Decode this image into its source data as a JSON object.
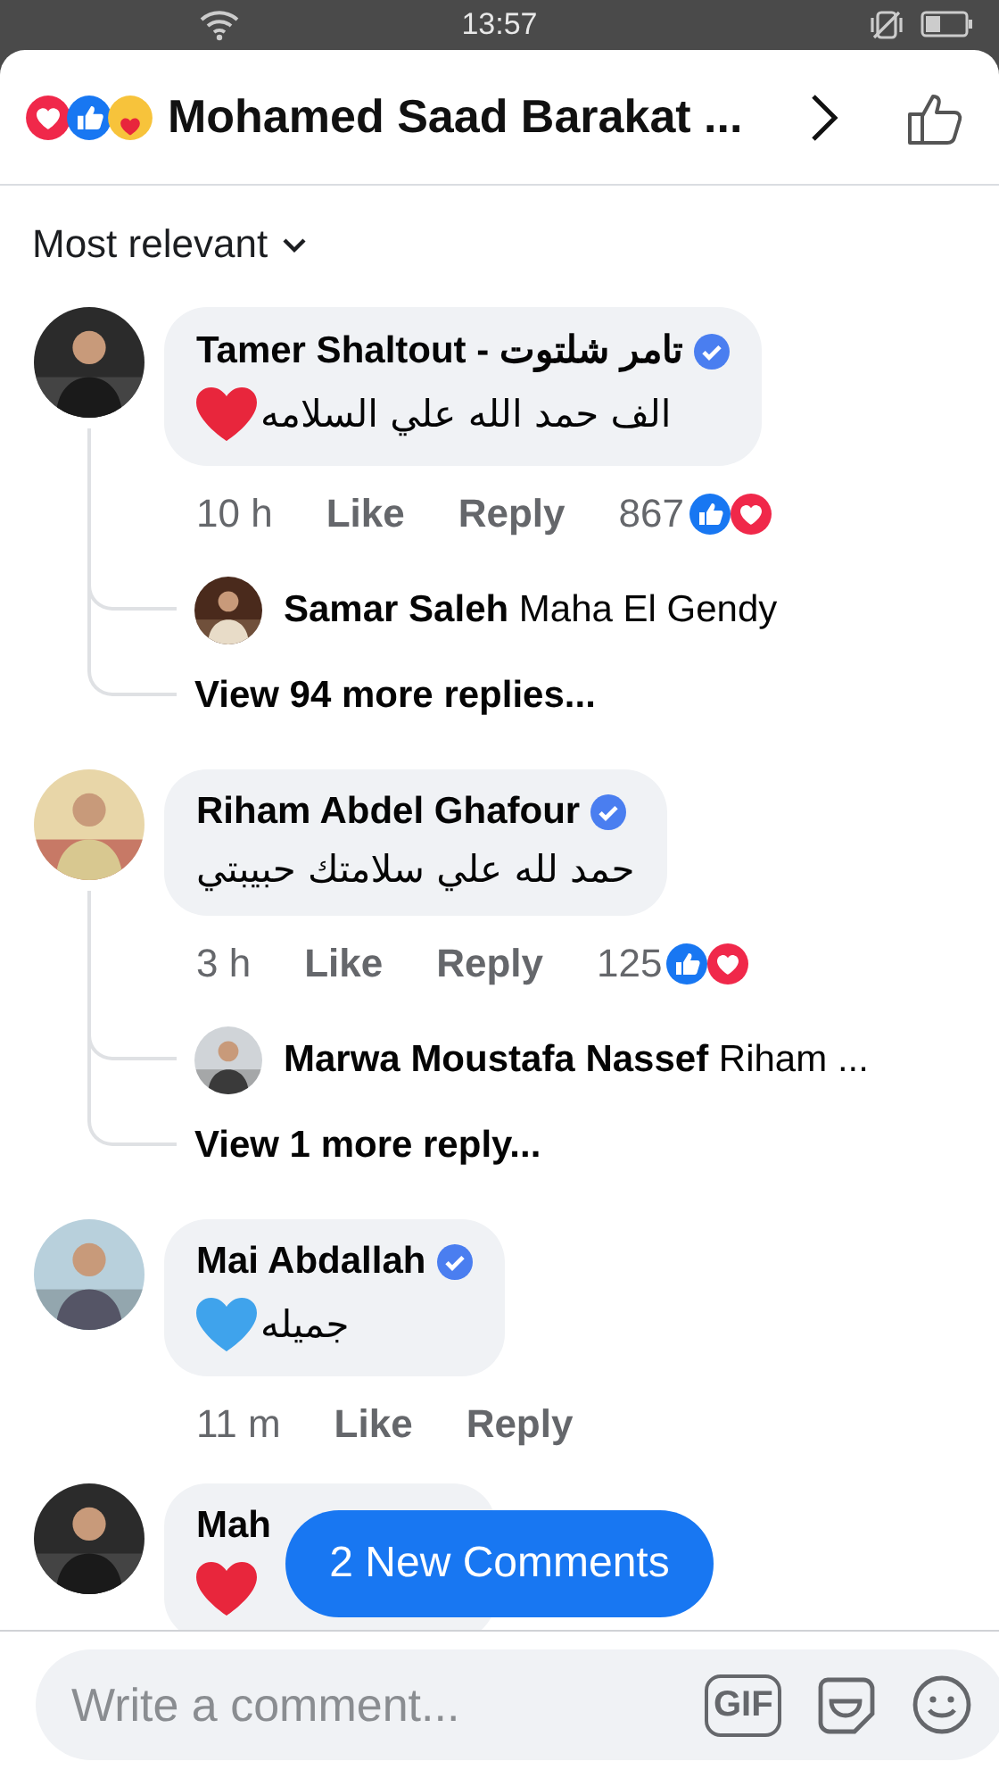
{
  "status_bar": {
    "time": "13:57"
  },
  "header": {
    "title": "Mohamed Saad Barakat ...",
    "reactions": [
      {
        "kind": "love"
      },
      {
        "kind": "like"
      },
      {
        "kind": "care"
      }
    ]
  },
  "sort": {
    "label": "Most relevant"
  },
  "comments": [
    {
      "author": "Tamer Shaltout - تامر شلتوت",
      "verified": true,
      "text": "الف حمد الله علي السلامه",
      "color": "#e8263c",
      "time": "10 h",
      "like": "Like",
      "reply": "Reply",
      "reaction_count": "867",
      "replies": [
        {
          "author": "Samar Saleh",
          "text": "Maha El Gendy"
        }
      ],
      "more_replies": "View 94 more replies..."
    },
    {
      "author": "Riham Abdel Ghafour",
      "verified": true,
      "text": "حمد لله علي سلامتك حبيبتي",
      "time": "3 h",
      "like": "Like",
      "reply": "Reply",
      "reaction_count": "125",
      "replies": [
        {
          "author": "Marwa Moustafa Nassef",
          "text": "Riham ..."
        }
      ],
      "more_replies": "View 1 more reply..."
    },
    {
      "author": "Mai Abdallah",
      "verified": true,
      "text": "جميله",
      "color": "#3fa3ec",
      "time": "11 m",
      "like": "Like",
      "reply": "Reply"
    },
    {
      "author": "Mah",
      "verified": false,
      "color": "#e8263c"
    }
  ],
  "new_comments_button": "2 New Comments",
  "composer": {
    "placeholder": "Write a comment...",
    "gif_label": "GIF"
  }
}
